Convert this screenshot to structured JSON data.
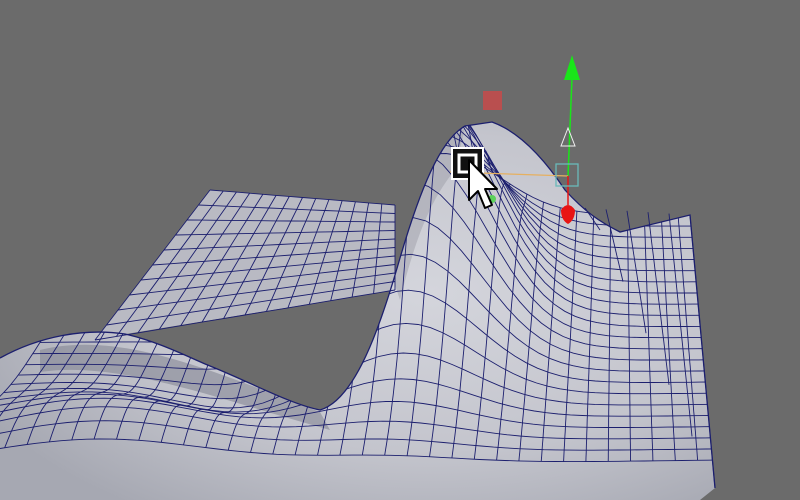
{
  "viewport": {
    "background_color": "#6b6b6b",
    "mesh": {
      "fill_color": "#c4c5cd",
      "wire_color": "#1c1f6e"
    },
    "manipulator": {
      "y_axis_color": "#19e619",
      "x_axis_color": "#e81414",
      "z_axis_color": "#e6b060",
      "center_handle_color": "#69b9b9",
      "free_move_handle_color": "#c24d4d"
    },
    "cursor_icon": "arrow-cursor-with-move-square"
  }
}
